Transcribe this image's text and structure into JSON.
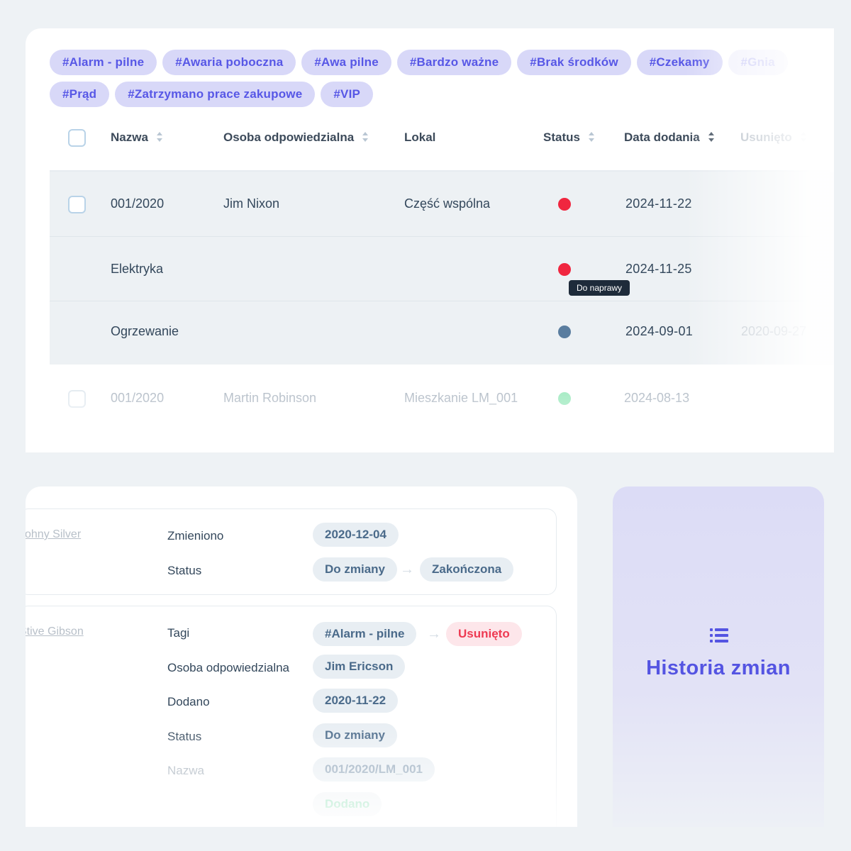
{
  "tags": {
    "row1": [
      "#Alarm - pilne",
      "#Awaria poboczna",
      "#Awa pilne",
      "#Bardzo ważne",
      "#Brak środków",
      "#Czekamy",
      "#Gnia"
    ],
    "row2": [
      "#Prąd",
      "#Zatrzymano prace zakupowe",
      "#VIP"
    ]
  },
  "table": {
    "headers": {
      "nazwa": "Nazwa",
      "osoba": "Osoba odpowiedzialna",
      "lokal": "Lokal",
      "status": "Status",
      "data": "Data dodania",
      "usunieto": "Usunięto"
    },
    "rows": [
      {
        "nazwa": "001/2020",
        "osoba": "Jim Nixon",
        "lokal": "Część wspólna",
        "status_color": "#f0263f",
        "data": "2024-11-22",
        "usunieto": ""
      },
      {
        "nazwa": "Elektryka",
        "osoba": "",
        "lokal": "",
        "status_color": "#f0263f",
        "data": "2024-11-25",
        "usunieto": ""
      },
      {
        "nazwa": "Ogrzewanie",
        "osoba": "",
        "lokal": "",
        "status_color": "#5a7d9f",
        "data": "2024-09-01",
        "usunieto": "2020-09-27"
      },
      {
        "nazwa": "001/2020",
        "osoba": "Martin Robinson",
        "lokal": "Mieszkanie LM_001",
        "status_color": "#a6ebc4",
        "data": "2024-08-13",
        "usunieto": ""
      }
    ],
    "tooltip": "Do naprawy"
  },
  "history": {
    "entry1": {
      "user": "Johny Silver",
      "fields": [
        {
          "label": "Zmieniono",
          "value": "2020-12-04"
        },
        {
          "label": "Status",
          "from": "Do zmiany",
          "to": "Zakończona"
        }
      ]
    },
    "entry2": {
      "user": "Stive Gibson",
      "fields": [
        {
          "label": "Tagi",
          "from": "#Alarm - pilne",
          "to": "Usunięto"
        },
        {
          "label": "Osoba odpowiedzialna",
          "value": "Jim Ericson"
        },
        {
          "label": "Dodano",
          "value": "2020-11-22"
        },
        {
          "label": "Status",
          "value": "Do zmiany"
        },
        {
          "label": "Nazwa",
          "value": "001/2020/LM_001"
        },
        {
          "label": "",
          "value": "Dodano"
        }
      ]
    }
  },
  "panel": {
    "icon": "list-icon",
    "title": "Historia zmian",
    "accent": "#5454e2"
  }
}
